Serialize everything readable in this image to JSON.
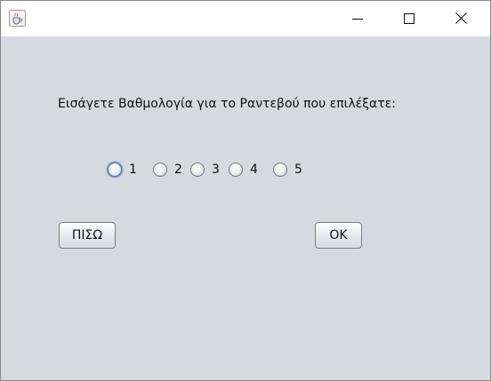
{
  "window": {
    "controls": {
      "minimize_icon": "minimize-icon",
      "maximize_icon": "maximize-icon",
      "close_icon": "close-icon"
    },
    "app_icon": "java-coffee-cup-icon"
  },
  "dialog": {
    "prompt": "Εισάγετε Βαθμολογία για το Ραντεβού που επιλέξατε:",
    "rating_options": [
      "1",
      "2",
      "3",
      "4",
      "5"
    ],
    "selected_rating": null,
    "focused_option": "1",
    "back_button": "ΠΙΣΩ",
    "ok_button": "OK"
  },
  "colors": {
    "content_background": "#d6d9df",
    "titlebar_background": "#ffffff",
    "focus_ring": "#7aa3cf"
  }
}
